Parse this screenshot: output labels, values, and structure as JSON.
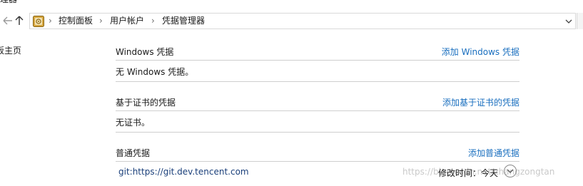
{
  "window": {
    "title_fragment": "理器"
  },
  "navigation": {
    "back_icon": "back-arrow-icon",
    "up_icon": "up-arrow-icon",
    "breadcrumb": [
      "控制面板",
      "用户帐户",
      "凭据管理器"
    ],
    "separator": "›"
  },
  "sidebar": {
    "home_link": "板主页"
  },
  "sections": {
    "windows": {
      "title": "Windows 凭据",
      "add_label": "添加 Windows 凭据",
      "empty_text": "无 Windows 凭据。"
    },
    "certificate": {
      "title": "基于证书的凭据",
      "add_label": "添加基于证书的凭据",
      "empty_text": "无证书。"
    },
    "generic": {
      "title": "普通凭据",
      "add_label": "添加普通凭据",
      "items": [
        {
          "name": "git:https://git.dev.tencent.com",
          "modified": "修改时间：今天"
        }
      ]
    }
  },
  "watermark": "https://blog.csdn.net/zhangzongtan",
  "colors": {
    "link": "#1a6fbf",
    "border": "#cfcfcf"
  }
}
